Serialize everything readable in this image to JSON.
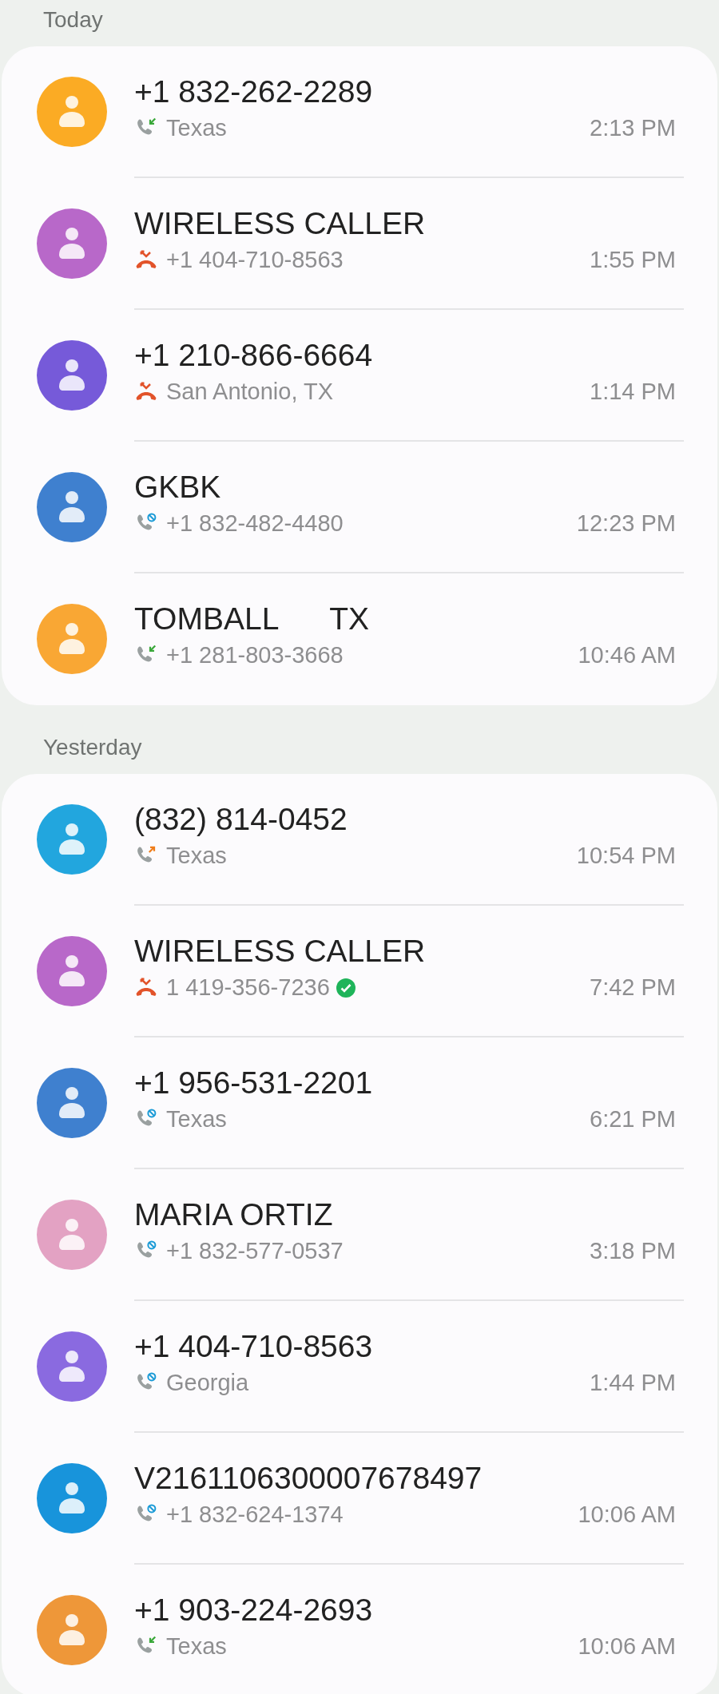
{
  "sections": [
    {
      "header": "Today",
      "calls": [
        {
          "name": "+1 832-262-2289",
          "detail": "Texas",
          "time": "2:13 PM",
          "kind": "incoming",
          "verified": false,
          "color": "#fbab24"
        },
        {
          "name": "WIRELESS CALLER",
          "detail": "+1 404-710-8563",
          "time": "1:55 PM",
          "kind": "rejected",
          "verified": false,
          "color": "#b868c9"
        },
        {
          "name": "+1 210-866-6664",
          "detail": "San Antonio, TX",
          "time": "1:14 PM",
          "kind": "rejected",
          "verified": false,
          "color": "#765ad9"
        },
        {
          "name": "GKBK",
          "detail": "+1 832-482-4480",
          "time": "12:23 PM",
          "kind": "blocked",
          "verified": false,
          "color": "#3f80cf"
        },
        {
          "name": "TOMBALL      TX",
          "detail": "+1 281-803-3668",
          "time": "10:46 AM",
          "kind": "incoming",
          "verified": false,
          "color": "#f9a734"
        }
      ]
    },
    {
      "header": "Yesterday",
      "calls": [
        {
          "name": "(832) 814-0452",
          "detail": "Texas",
          "time": "10:54 PM",
          "kind": "outgoing",
          "verified": false,
          "color": "#22a6de"
        },
        {
          "name": "WIRELESS CALLER",
          "detail": "1 419-356-7236",
          "time": "7:42 PM",
          "kind": "rejected",
          "verified": true,
          "color": "#b868c9"
        },
        {
          "name": "+1 956-531-2201",
          "detail": "Texas",
          "time": "6:21 PM",
          "kind": "blocked",
          "verified": false,
          "color": "#3f80cf"
        },
        {
          "name": "MARIA ORTIZ",
          "detail": "+1 832-577-0537",
          "time": "3:18 PM",
          "kind": "blocked",
          "verified": false,
          "color": "#e3a2c3"
        },
        {
          "name": "+1 404-710-8563",
          "detail": "Georgia",
          "time": "1:44 PM",
          "kind": "blocked",
          "verified": false,
          "color": "#8a6ae0"
        },
        {
          "name": "V2161106300007678497",
          "detail": "+1 832-624-1374",
          "time": "10:06 AM",
          "kind": "blocked",
          "verified": false,
          "color": "#1894db"
        },
        {
          "name": "+1 903-224-2693",
          "detail": "Texas",
          "time": "10:06 AM",
          "kind": "incoming",
          "verified": false,
          "color": "#ee9739"
        }
      ]
    }
  ]
}
